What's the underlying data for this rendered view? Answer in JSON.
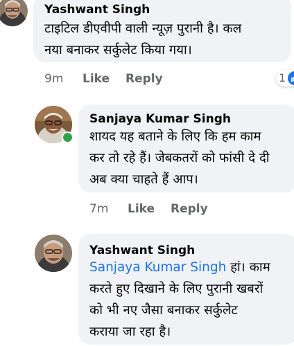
{
  "comments": [
    {
      "author": "Yashwant Singh",
      "lines": [
        "टाइटिल डीएवीपी वाली न्यूज़ पुरानी है। कल",
        "नया बनाकर सर्कुलेट किया गया।"
      ],
      "time": "9m",
      "like_label": "Like",
      "reply_label": "Reply",
      "reaction_count": "1",
      "avatar_icon": "user-avatar-icon"
    },
    {
      "author": "Sanjaya Kumar Singh",
      "online": true,
      "lines": [
        "शायद यह बताने के लिए कि हम काम",
        "कर तो रहे हैं। जेबकतरों को फांसी दे दी",
        "अब क्या चाहते हैं आप।"
      ],
      "time": "7m",
      "like_label": "Like",
      "reply_label": "Reply",
      "avatar_icon": "user-avatar-icon"
    },
    {
      "author": "Yashwant Singh",
      "mention": "Sanjaya Kumar Singh",
      "line1_rest": " हां। काम",
      "lines": [
        "करते हुए दिखाने के लिए पुरानी खबरों",
        "को भी नए जैसा बनाकर सर्कुलेट",
        "कराया जा रहा है।"
      ],
      "avatar_icon": "user-avatar-icon"
    }
  ],
  "colors": {
    "bubble": "#f0f2f5",
    "meta_text": "#65676b",
    "mention": "#1b74e4",
    "online": "#31a24c",
    "like_blue": "#1877f2"
  }
}
